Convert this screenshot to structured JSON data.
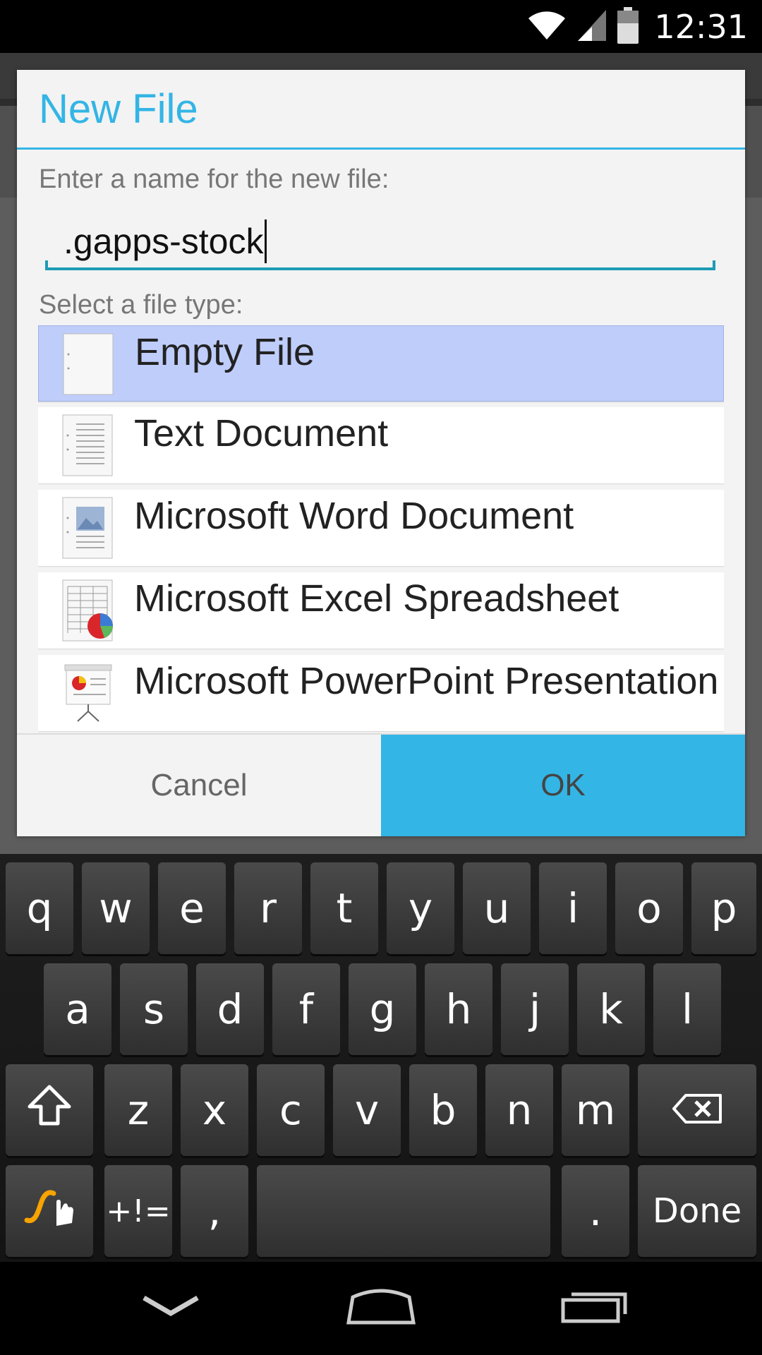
{
  "status_bar": {
    "time": "12:31",
    "icons": [
      "wifi-icon",
      "cell-signal-icon",
      "battery-icon"
    ]
  },
  "dialog": {
    "title": "New File",
    "prompt": "Enter a name for the new file:",
    "filename": ".gapps-stock",
    "type_prompt": "Select a file type:",
    "file_types": [
      {
        "label": "Empty File",
        "icon": "empty-file-icon",
        "selected": true
      },
      {
        "label": "Text Document",
        "icon": "text-document-icon",
        "selected": false
      },
      {
        "label": "Microsoft Word Document",
        "icon": "word-document-icon",
        "selected": false
      },
      {
        "label": "Microsoft Excel Spreadsheet",
        "icon": "excel-spreadsheet-icon",
        "selected": false
      },
      {
        "label": "Microsoft PowerPoint Presentation",
        "icon": "powerpoint-presentation-icon",
        "selected": false
      }
    ],
    "cancel_label": "Cancel",
    "ok_label": "OK"
  },
  "keyboard": {
    "row1": [
      "q",
      "w",
      "e",
      "r",
      "t",
      "y",
      "u",
      "i",
      "o",
      "p"
    ],
    "row2": [
      "a",
      "s",
      "d",
      "f",
      "g",
      "h",
      "j",
      "k",
      "l"
    ],
    "row3": [
      "z",
      "x",
      "c",
      "v",
      "b",
      "n",
      "m"
    ],
    "symbols_label": "+!=",
    "comma_label": ",",
    "period_label": ".",
    "done_label": "Done",
    "accent": "#f7a300"
  },
  "colors": {
    "accent": "#33b5e5",
    "selection": "#bfcdfb"
  }
}
